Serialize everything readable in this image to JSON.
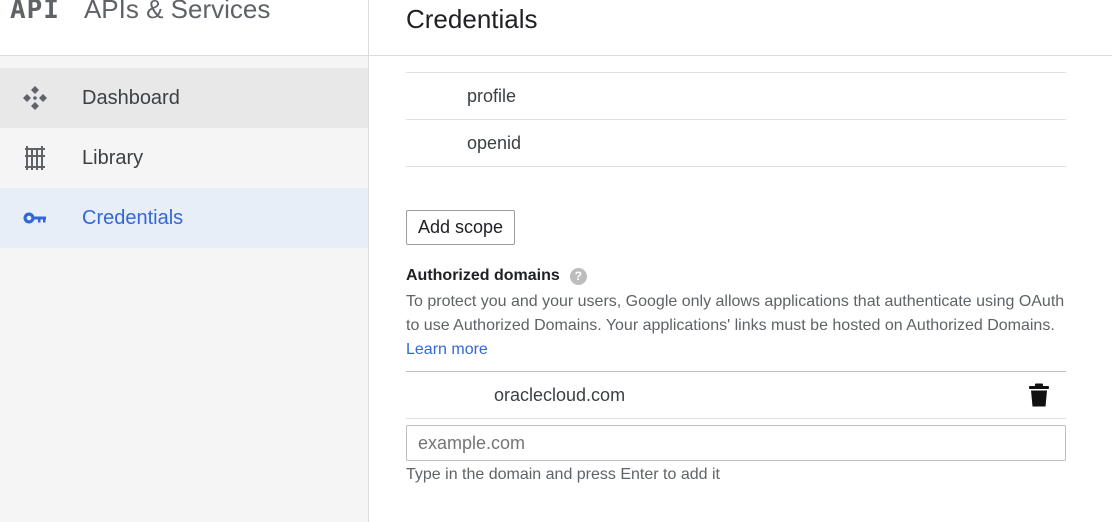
{
  "sidebar": {
    "logo": "API",
    "title": "APIs & Services",
    "items": [
      {
        "label": "Dashboard",
        "icon": "dashboard-icon"
      },
      {
        "label": "Library",
        "icon": "library-icon"
      },
      {
        "label": "Credentials",
        "icon": "key-icon"
      }
    ]
  },
  "header": {
    "title": "Credentials"
  },
  "scopes": [
    "profile",
    "openid"
  ],
  "add_scope_label": "Add scope",
  "authorized_domains": {
    "title": "Authorized domains",
    "description": "To protect you and your users, Google only allows applications that authenticate using OAuth to use Authorized Domains. Your applications' links must be hosted on Authorized Domains.",
    "learn_more": "Learn more",
    "domains": [
      "oraclecloud.com"
    ],
    "input_placeholder": "example.com",
    "hint": "Type in the domain and press Enter to add it"
  },
  "colors": {
    "accent": "#3367d6",
    "active_bg": "#e8eef8"
  }
}
